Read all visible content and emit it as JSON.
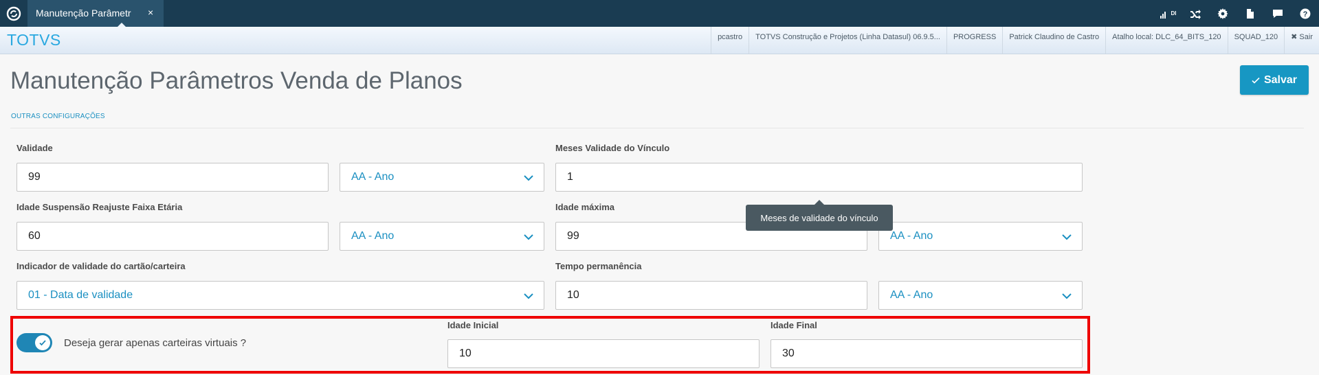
{
  "topbar": {
    "tab_label": "Manutenção Parâmetr",
    "tab_close": "×",
    "signal_label": "DI"
  },
  "header": {
    "brand": "TOTVS",
    "user": "pcastro",
    "company": "TOTVS Construção e Projetos (Linha Datasul) 06.9.5...",
    "database": "PROGRESS",
    "full_name": "Patrick Claudino de Castro",
    "shortcut": "Atalho local: DLC_64_BITS_120",
    "squad": "SQUAD_120",
    "logout": "✖ Sair"
  },
  "page": {
    "title": "Manutenção Parâmetros Venda de Planos",
    "save_label": "Salvar",
    "section": "OUTRAS CONFIGURAÇÕES"
  },
  "form": {
    "validade_label": "Validade",
    "validade_value": "99",
    "validade_unit": "AA - Ano",
    "meses_label": "Meses Validade do Vínculo",
    "meses_value": "1",
    "idade_susp_label": "Idade Suspensão Reajuste Faixa Etária",
    "idade_susp_value": "60",
    "idade_susp_unit": "AA - Ano",
    "idade_max_label": "Idade máxima",
    "idade_max_value": "99",
    "idade_max_unit": "AA - Ano",
    "indicador_label": "Indicador de validade do cartão/carteira",
    "indicador_value": "01 - Data de validade",
    "tempo_label": "Tempo permanência",
    "tempo_value": "10",
    "tempo_unit": "AA - Ano",
    "toggle_label": "Deseja gerar apenas carteiras virtuais ?",
    "toggle_on": true,
    "idade_inicial_label": "Idade Inicial",
    "idade_inicial_value": "10",
    "idade_final_label": "Idade Final",
    "idade_final_value": "30"
  },
  "tooltip": {
    "text": "Meses de validade do vínculo"
  },
  "colors": {
    "accent": "#1797c3",
    "topbar": "#1a3c52",
    "highlight": "#ee0000"
  }
}
